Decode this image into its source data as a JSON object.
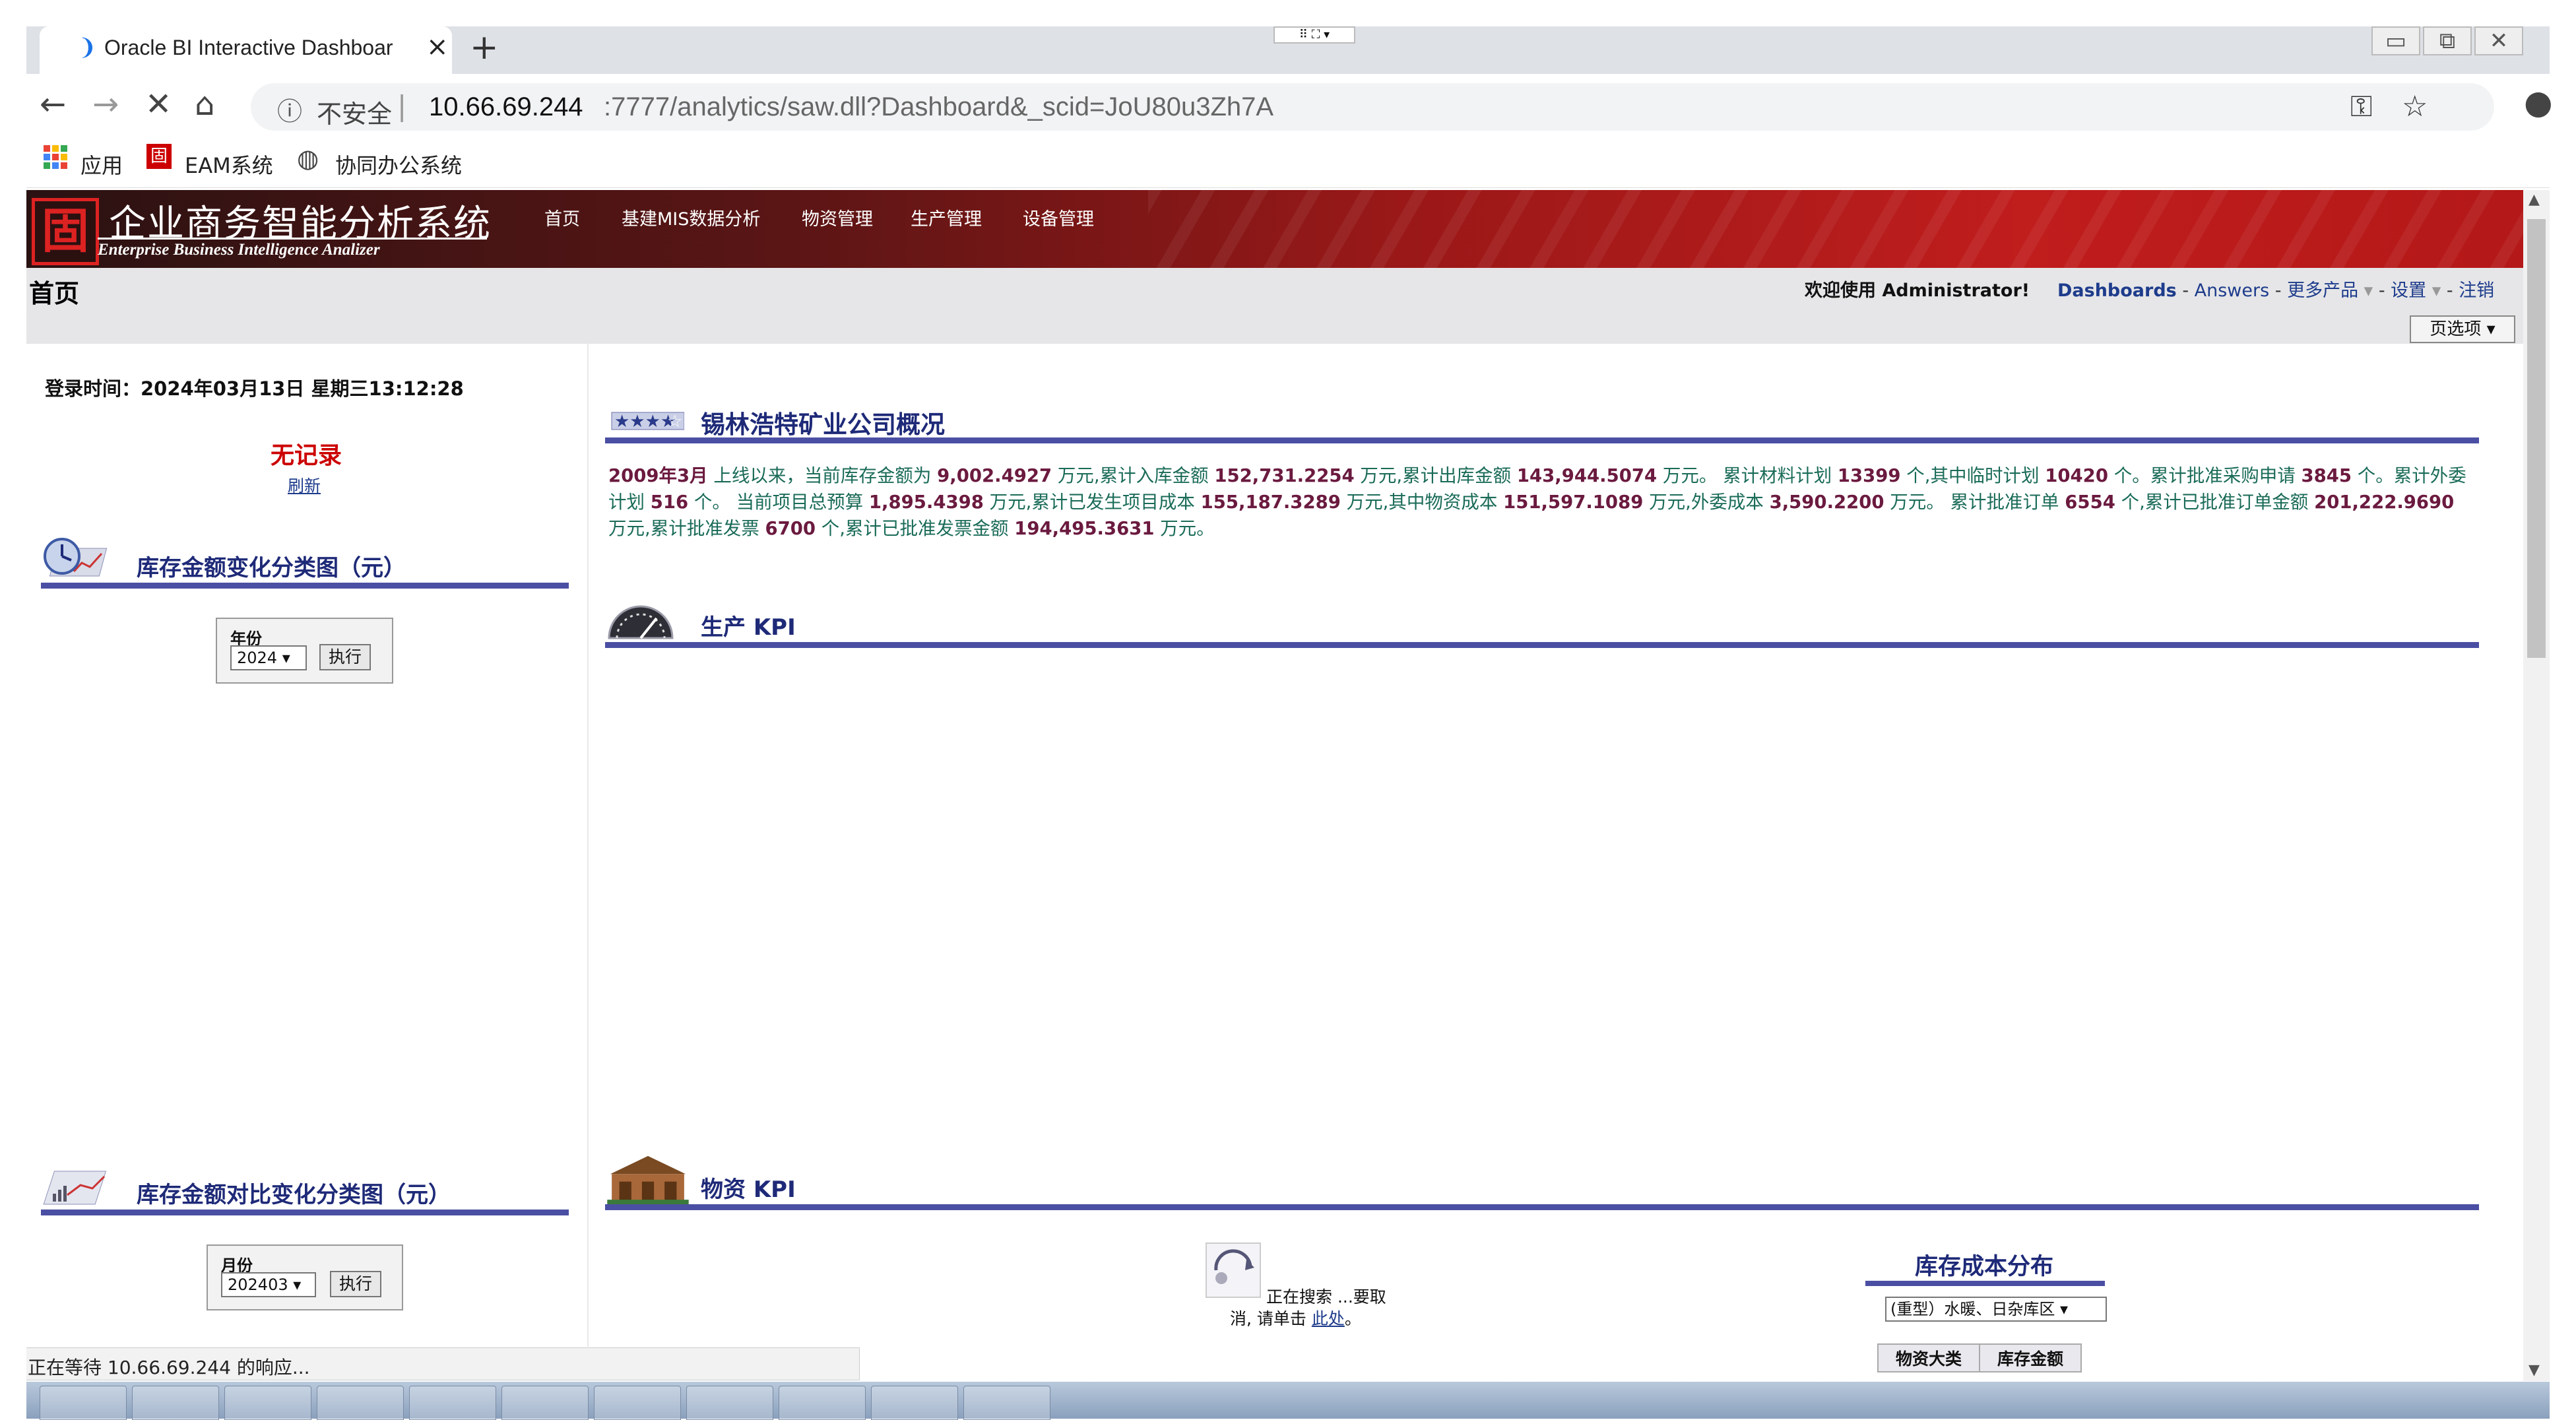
{
  "browser": {
    "tab_title": "Oracle BI Interactive Dashboar",
    "insecure_label": "不安全",
    "url_host": "10.66.69.244",
    "url_rest": ":7777/analytics/saw.dll?Dashboard&_scid=JoU80u3Zh7A",
    "bookmarks": [
      "应用",
      "EAM系统",
      "协同办公系统"
    ]
  },
  "banner": {
    "brand_cn": "企业商务智能分析系统",
    "brand_en": "Enterprise Business Intelligence Analizer",
    "logo_glyph": "固",
    "nav": [
      "首页",
      "基建MIS数据分析",
      "物资管理",
      "生产管理",
      "设备管理"
    ]
  },
  "header": {
    "page_title": "首页",
    "welcome": "欢迎使用 Administrator!",
    "links": [
      "Dashboards",
      "Answers",
      "更多产品",
      "设置",
      "注销"
    ],
    "page_options": "页选项"
  },
  "left": {
    "login_time": "登录时间：2024年03月13日 星期三13:12:28",
    "no_record": "无记录",
    "refresh": "刷新",
    "inventory_change_title": "库存金额变化分类图（元）",
    "year_prompt": {
      "label": "年份",
      "value": "2024",
      "go": "执行"
    },
    "inventory_compare_title": "库存金额对比变化分类图（元）",
    "month_prompt": {
      "label": "月份",
      "value": "202403",
      "go": "执行"
    }
  },
  "right": {
    "overview_title": "锡林浩特矿业公司概况",
    "overview": {
      "online_date": "2009年3月",
      "t1": " 上线以来，当前库存金额为 ",
      "v_stock": "9,002.4927",
      "t2": " 万元,累计入库金额 ",
      "v_in": "152,731.2254",
      "t3": " 万元,累计出库金额 ",
      "v_out": "143,944.5074",
      "t4": " 万元。 累计材料计划 ",
      "v_plan": "13399",
      "t5": " 个,其中临时计划 ",
      "v_temp": "10420",
      "t6": " 个。累计批准采购申请 ",
      "v_req": "3845",
      "t7": " 个。累计外委计划 ",
      "v_out_plan": "516",
      "t8": " 个。 当前项目总预算 ",
      "v_budget": "1,895.4398",
      "t9": " 万元,累计已发生项目成本 ",
      "v_cost": "155,187.3289",
      "t10": " 万元,其中物资成本 ",
      "v_mat": "151,597.1089",
      "t11": " 万元,外委成本 ",
      "v_ext": "3,590.2200",
      "t12": " 万元。 累计批准订单 ",
      "v_orders": "6554",
      "t13": " 个,累计已批准订单金额 ",
      "v_order_amt": "201,222.9690",
      "t14": " 万元,累计批准发票 ",
      "v_inv": "6700",
      "t15": " 个,累计已批准发票金额 ",
      "v_inv_amt": "194,495.3631",
      "t16": " 万元。"
    },
    "production_kpi_title": "生产 KPI",
    "material_kpi_title": "物资 KPI",
    "loading_line1": "正在搜索 ...要取",
    "loading_line2": "消, 请单击 ",
    "loading_link": "此处",
    "loading_end": "。",
    "cost_title": "库存成本分布",
    "cost_select": "(重型）水暖、日杂库区",
    "cost_table_headers": [
      "物资大类",
      "库存金额"
    ]
  },
  "status": {
    "text": "正在等待 10.66.69.244 的响应..."
  },
  "colors": {
    "accent": "#4b4fa3",
    "title": "#1e2a78",
    "banner": "#b41818",
    "alert": "#cc0000"
  }
}
